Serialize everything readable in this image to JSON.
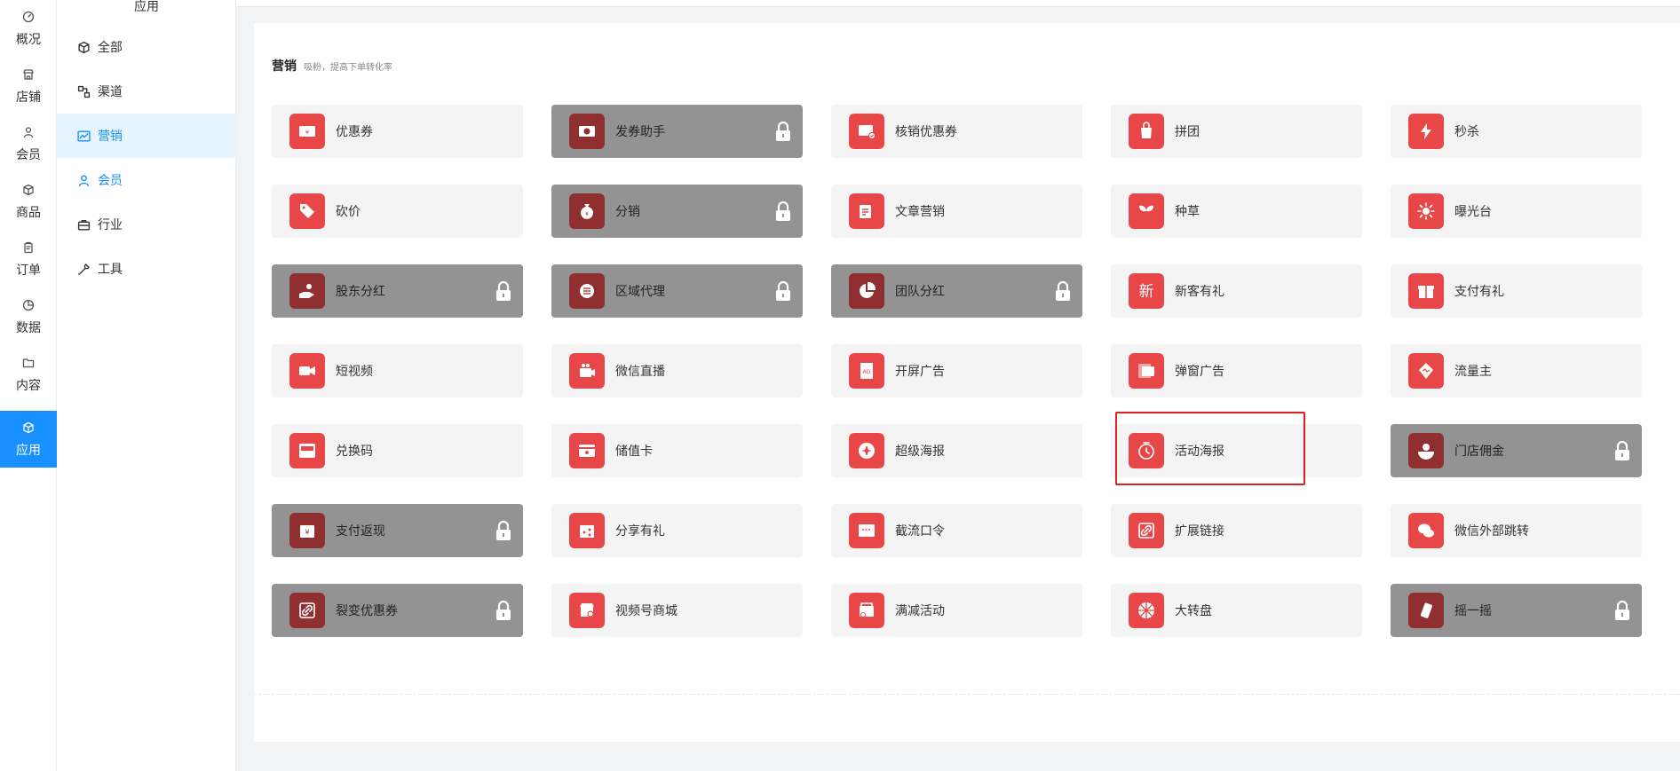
{
  "rail": {
    "items": [
      {
        "label": "概况",
        "icon": "dashboard-icon"
      },
      {
        "label": "店铺",
        "icon": "store-icon"
      },
      {
        "label": "会员",
        "icon": "user-icon"
      },
      {
        "label": "商品",
        "icon": "box-icon"
      },
      {
        "label": "订单",
        "icon": "clipboard-icon"
      },
      {
        "label": "数据",
        "icon": "pie-icon"
      },
      {
        "label": "内容",
        "icon": "folder-icon"
      },
      {
        "label": "应用",
        "icon": "cube-icon"
      }
    ],
    "active_index": 7
  },
  "subnav": {
    "title": "应用",
    "items": [
      {
        "label": "全部",
        "icon": "cube-icon"
      },
      {
        "label": "渠道",
        "icon": "channels-icon"
      },
      {
        "label": "营销",
        "icon": "trend-icon"
      },
      {
        "label": "会员",
        "icon": "user-icon"
      },
      {
        "label": "行业",
        "icon": "briefcase-icon"
      },
      {
        "label": "工具",
        "icon": "wrench-icon"
      }
    ],
    "active_index": 2
  },
  "section": {
    "title": "营销",
    "desc": "吸粉，提高下单转化率"
  },
  "tiles": [
    {
      "label": "优惠券",
      "locked": false,
      "icon": "coupon-icon"
    },
    {
      "label": "发券助手",
      "locked": true,
      "icon": "coupon-helper-icon"
    },
    {
      "label": "核销优惠券",
      "locked": false,
      "icon": "verify-coupon-icon"
    },
    {
      "label": "拼团",
      "locked": false,
      "icon": "group-buy-icon"
    },
    {
      "label": "秒杀",
      "locked": false,
      "icon": "lightning-icon"
    },
    {
      "label": "砍价",
      "locked": false,
      "icon": "bargain-tag-icon"
    },
    {
      "label": "分销",
      "locked": true,
      "icon": "money-bag-icon"
    },
    {
      "label": "文章营销",
      "locked": false,
      "icon": "article-icon"
    },
    {
      "label": "种草",
      "locked": false,
      "icon": "sprout-icon"
    },
    {
      "label": "曝光台",
      "locked": false,
      "icon": "sun-icon"
    },
    {
      "label": "股东分红",
      "locked": true,
      "icon": "hand-coins-icon"
    },
    {
      "label": "区域代理",
      "locked": true,
      "icon": "coins-stack-icon"
    },
    {
      "label": "团队分红",
      "locked": true,
      "icon": "pie-chart-icon"
    },
    {
      "label": "新客有礼",
      "locked": false,
      "icon": "new-char-icon"
    },
    {
      "label": "支付有礼",
      "locked": false,
      "icon": "gift-icon"
    },
    {
      "label": "短视频",
      "locked": false,
      "icon": "video-camera-icon"
    },
    {
      "label": "微信直播",
      "locked": false,
      "icon": "live-camera-icon"
    },
    {
      "label": "开屏广告",
      "locked": false,
      "icon": "ad-screen-icon"
    },
    {
      "label": "弹窗广告",
      "locked": false,
      "icon": "popup-ad-icon"
    },
    {
      "label": "流量主",
      "locked": false,
      "icon": "traffic-icon"
    },
    {
      "label": "兑换码",
      "locked": false,
      "icon": "redeem-code-icon"
    },
    {
      "label": "储值卡",
      "locked": false,
      "icon": "card-icon"
    },
    {
      "label": "超级海报",
      "locked": false,
      "icon": "super-poster-icon"
    },
    {
      "label": "活动海报",
      "locked": false,
      "icon": "activity-poster-icon"
    },
    {
      "label": "门店佣金",
      "locked": true,
      "icon": "store-commission-icon"
    },
    {
      "label": "支付返现",
      "locked": true,
      "icon": "cashback-icon"
    },
    {
      "label": "分享有礼",
      "locked": false,
      "icon": "share-gift-icon"
    },
    {
      "label": "截流口令",
      "locked": false,
      "icon": "password-icon"
    },
    {
      "label": "扩展链接",
      "locked": false,
      "icon": "link-icon"
    },
    {
      "label": "微信外部跳转",
      "locked": false,
      "icon": "wechat-icon"
    },
    {
      "label": "裂变优惠券",
      "locked": true,
      "icon": "fission-coupon-icon"
    },
    {
      "label": "视频号商城",
      "locked": false,
      "icon": "channel-shop-icon"
    },
    {
      "label": "满减活动",
      "locked": false,
      "icon": "discount-icon"
    },
    {
      "label": "大转盘",
      "locked": false,
      "icon": "wheel-icon"
    },
    {
      "label": "摇一摇",
      "locked": true,
      "icon": "shake-icon"
    }
  ],
  "highlighted_tile": "活动海报",
  "colors": {
    "accent": "#1890ff",
    "tile_icon": "#e84747",
    "tile_icon_locked": "#8f2f2f",
    "locked_bg": "#939393",
    "highlight": "#e02020"
  }
}
